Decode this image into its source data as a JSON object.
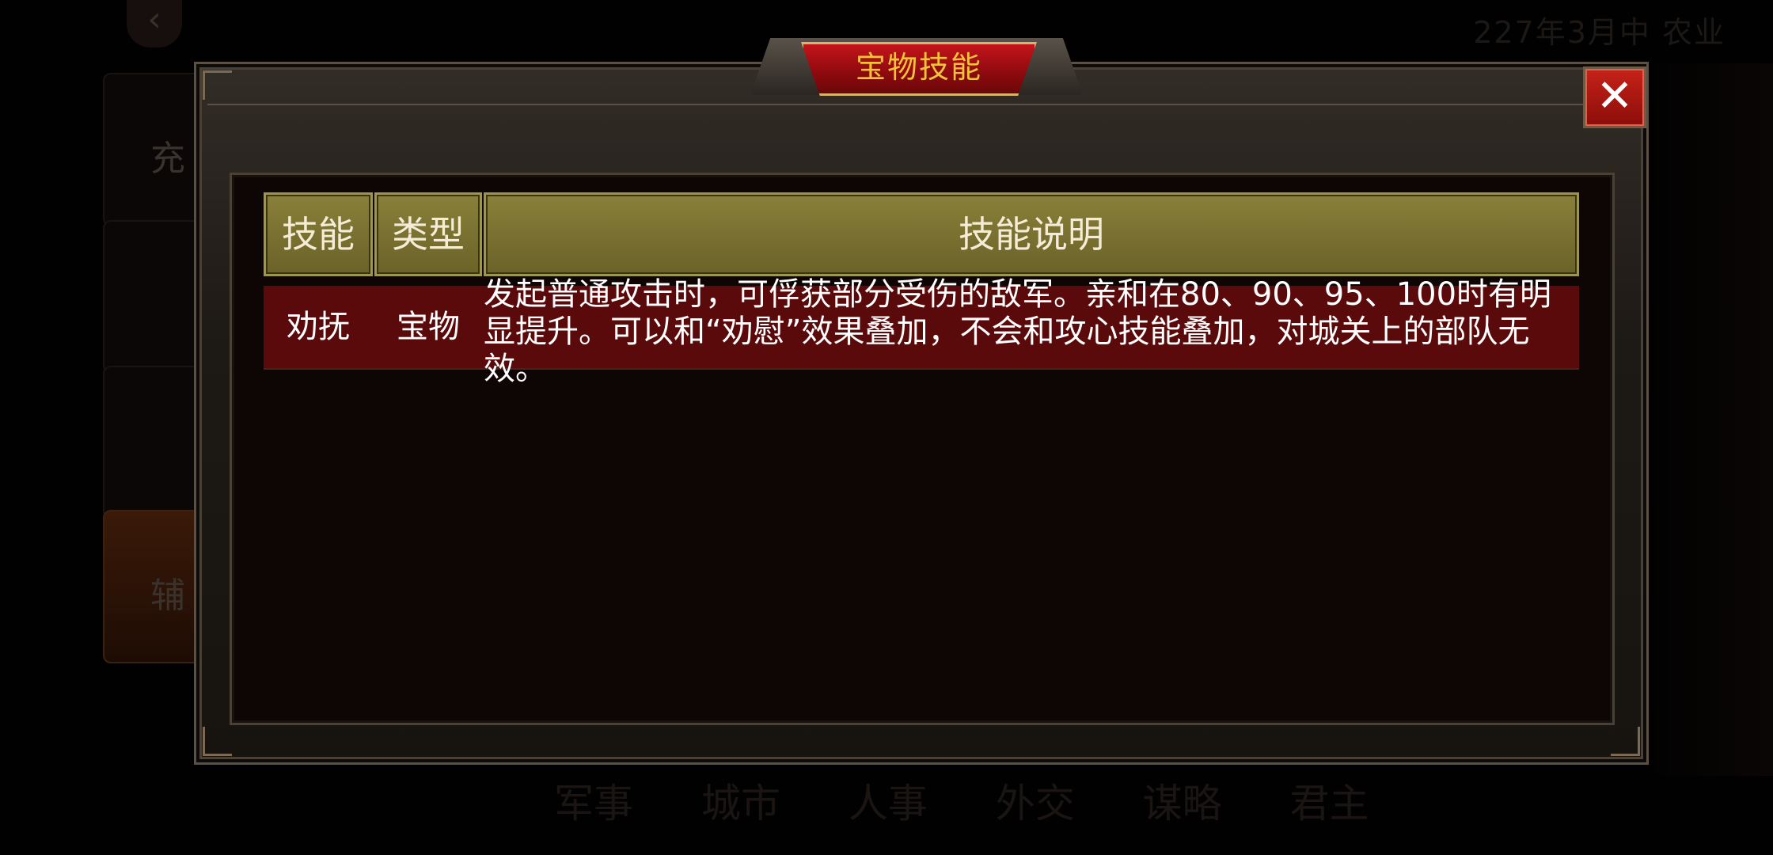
{
  "background": {
    "top_bar_text": "",
    "date_text": "227年3月中 农业",
    "side_labels": [
      "充",
      "",
      "",
      "辅"
    ],
    "bottom_tabs": [
      "军事",
      "城市",
      "人事",
      "外交",
      "谋略",
      "君主"
    ]
  },
  "dialog": {
    "title": "宝物技能",
    "close_icon": "close-icon"
  },
  "table": {
    "headers": {
      "skill": "技能",
      "type": "类型",
      "description": "技能说明"
    },
    "rows": [
      {
        "skill": "劝抚",
        "type": "宝物",
        "description": "发起普通攻击时，可俘获部分受伤的敌军。亲和在80、90、95、100时有明显提升。可以和“劝慰”效果叠加，不会和攻心技能叠加，对城关上的部队无效。"
      }
    ]
  },
  "colors": {
    "title_text": "#f2c23a",
    "title_plate": "#c4141a",
    "header_bg": "#89803a",
    "row_bg": "#5a0a0a",
    "close_button": "#c62218"
  }
}
